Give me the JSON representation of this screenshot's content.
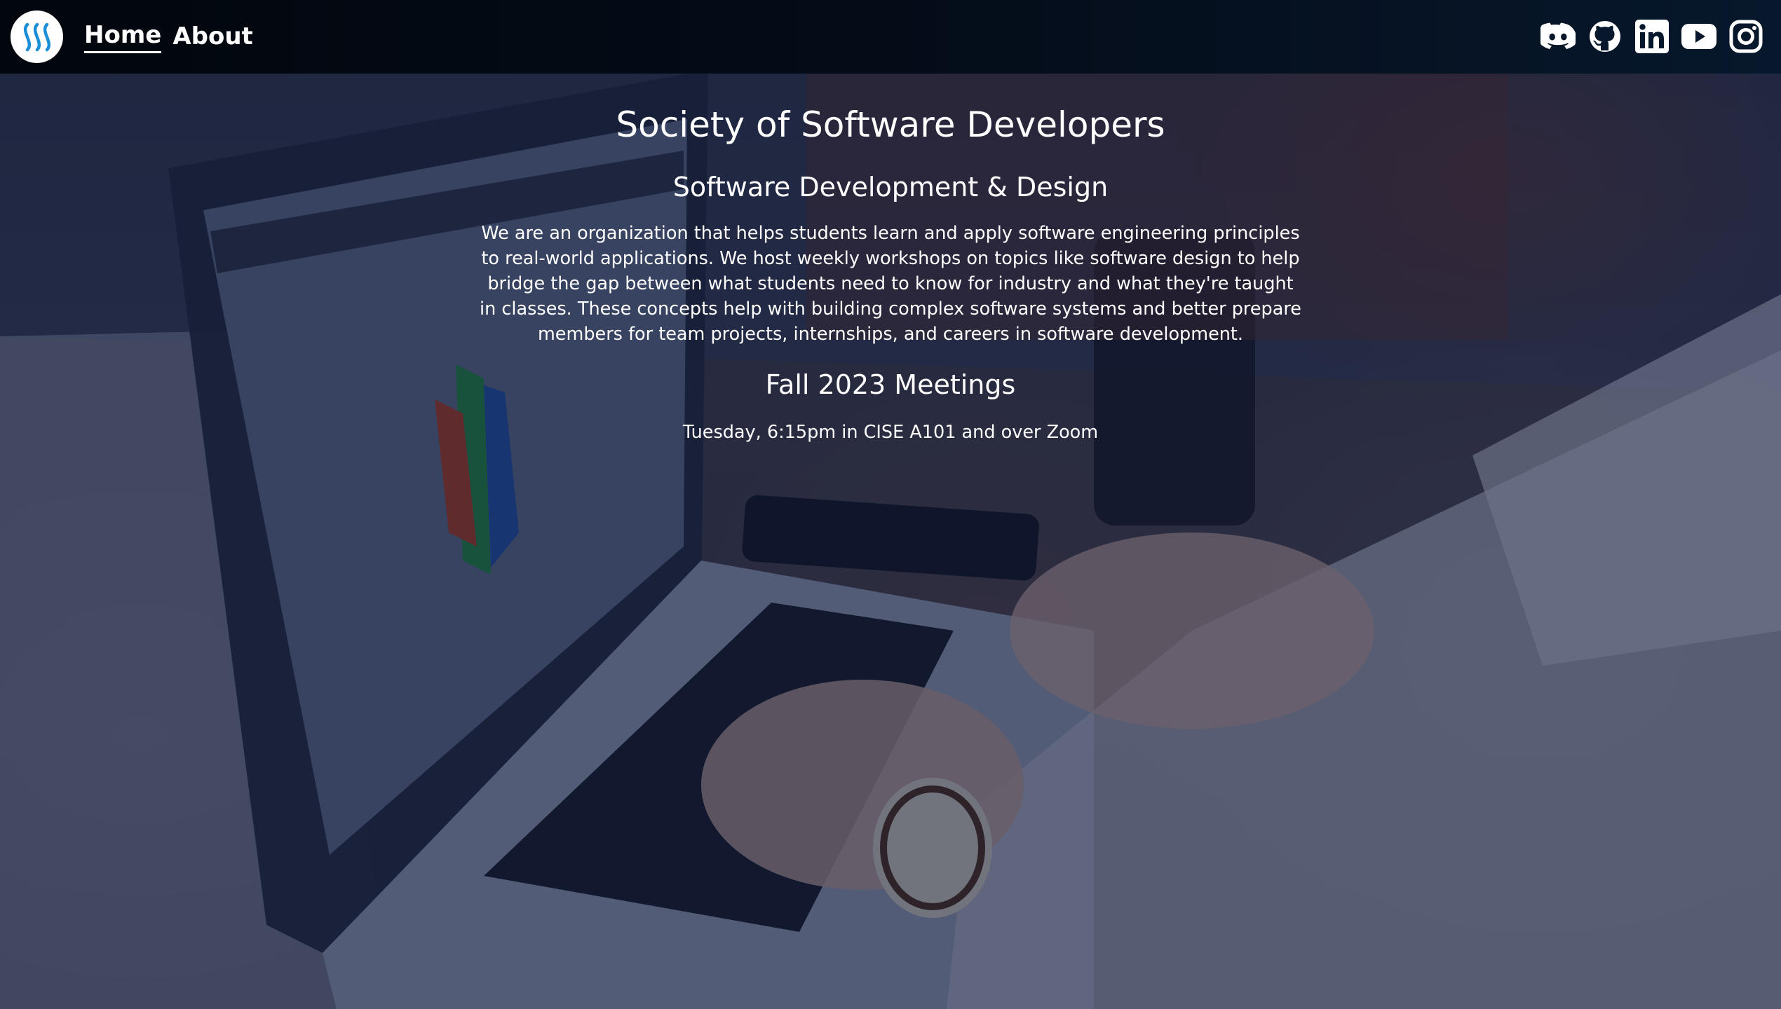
{
  "nav": {
    "logo_icon": "sosd-logo-icon",
    "links": [
      {
        "label": "Home",
        "active": true
      },
      {
        "label": "About",
        "active": false
      }
    ],
    "social_icons": [
      "discord-icon",
      "github-icon",
      "linkedin-icon",
      "youtube-icon",
      "instagram-icon"
    ]
  },
  "hero": {
    "title": "Society of Software Developers",
    "subtitle": "Software Development & Design",
    "description": "We are an organization that helps students learn and apply software engineering principles to real-world applications. We host weekly workshops on topics like software design to help bridge the gap between what students need to know for industry and what they're taught in classes. These concepts help with building complex software systems and better prepare members for team projects, internships, and careers in software development.",
    "meetings_title": "Fall 2023 Meetings",
    "meetings_text": "Tuesday, 6:15pm in CISE A101 and over Zoom"
  },
  "colors": {
    "navbar": "#02060d",
    "overlay": "#061030",
    "text": "#ffffff",
    "logo_blue": "#1a8fd8"
  }
}
